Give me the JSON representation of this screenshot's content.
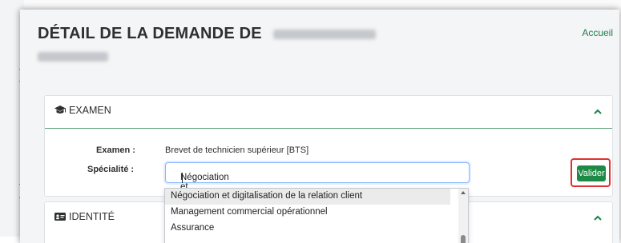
{
  "page": {
    "title": "DÉTAIL DE LA DEMANDE DE",
    "home_link": "Accueil"
  },
  "exam_section": {
    "title": "EXAMEN",
    "icon": "graduation-cap-icon",
    "exam_label": "Examen :",
    "exam_value": "Brevet de technicien supérieur [BTS]",
    "specialty_label": "Spécialité :",
    "specialty_value": "Négociation et digitalisation de la relation client",
    "validate_label": "Valider"
  },
  "dropdown": {
    "options": [
      "Négociation et digitalisation de la relation client",
      "Management commercial opérationnel",
      "Assurance"
    ],
    "highlighted_index": 0
  },
  "identity_section": {
    "title": "IDENTITÉ",
    "icon": "id-card-icon"
  },
  "colors": {
    "accent_green": "#1f8a45",
    "highlight_red": "#e03131",
    "focus_blue": "#86b7fe",
    "divider_green": "#5a9d75"
  }
}
